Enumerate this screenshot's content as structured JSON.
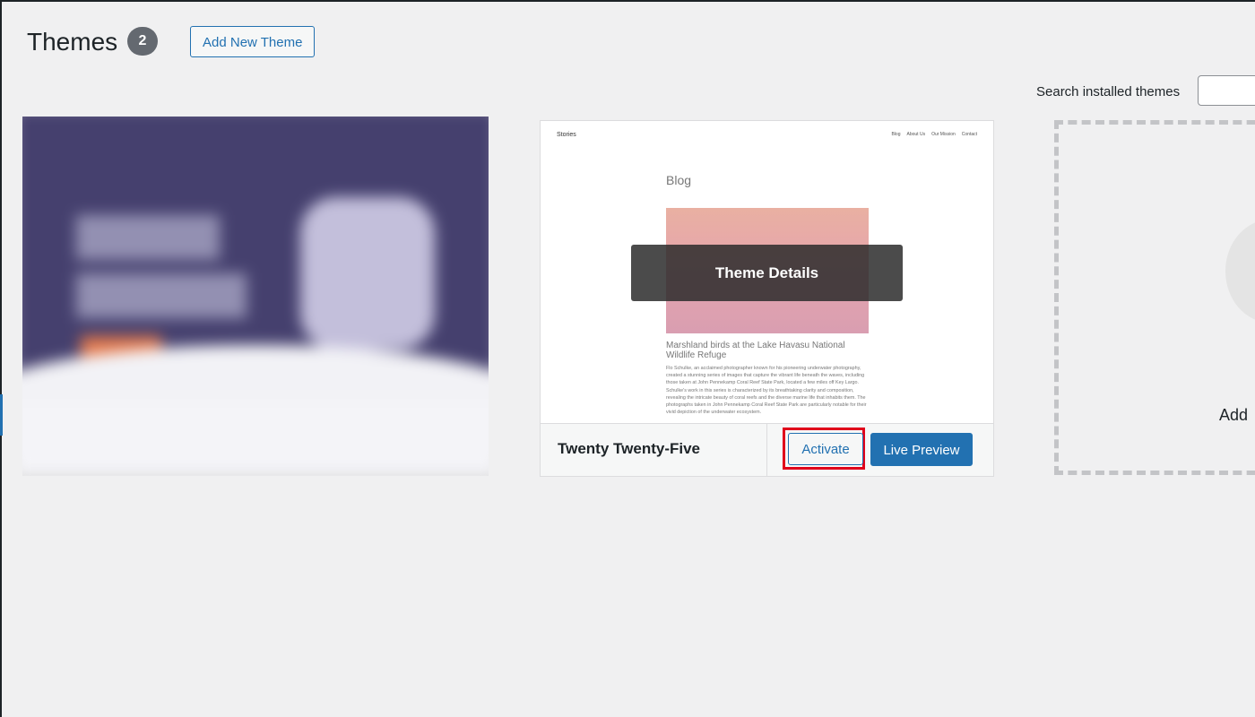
{
  "header": {
    "title": "Themes",
    "count": "2",
    "add_new_label": "Add New Theme"
  },
  "search": {
    "label": "Search installed themes",
    "value": ""
  },
  "theme_card": {
    "name": "Twenty Twenty-Five",
    "details_label": "Theme Details",
    "activate_label": "Activate",
    "live_preview_label": "Live Preview",
    "screenshot": {
      "site_title": "Stories",
      "nav": [
        "Blog",
        "About Us",
        "Our Mission",
        "Contact"
      ],
      "heading": "Blog",
      "post_title": "Marshland birds at the Lake Havasu National Wildlife Refuge",
      "excerpt": "Flo Schulke, an acclaimed photographer known for his pioneering underwater photography, created a stunning series of images that capture the vibrant life beneath the waves, including those taken at John Pennekamp Coral Reef State Park, located a few miles off Key Largo. Schulke's work in this series is characterized by its breathtaking clarity and composition, revealing the intricate beauty of coral reefs and the diverse marine life that inhabits them. The photographs taken in John Pennekamp Coral Reef State Park are particularly notable for their vivid depiction of the underwater ecosystem."
    }
  },
  "add_card": {
    "label": "Add"
  },
  "colors": {
    "accent": "#2271b1",
    "highlight": "#e0001b",
    "badge": "#646970",
    "background": "#f0f0f1"
  }
}
